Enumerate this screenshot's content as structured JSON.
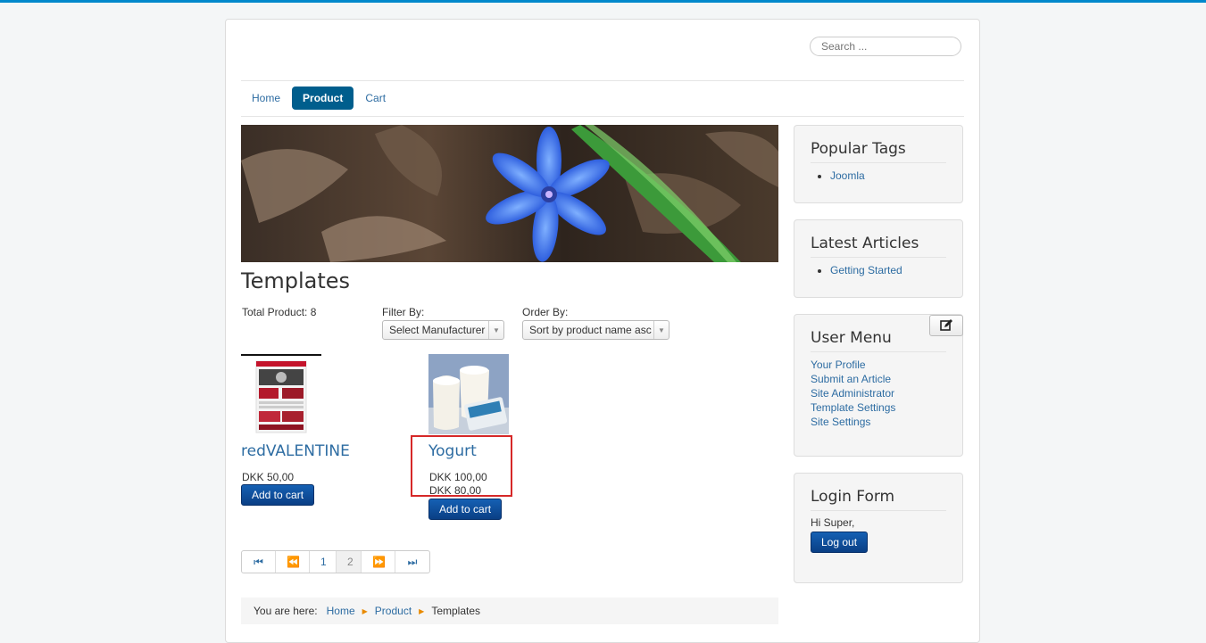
{
  "search": {
    "placeholder": "Search ..."
  },
  "nav": {
    "items": [
      "Home",
      "Product",
      "Cart"
    ],
    "active": "Product"
  },
  "main": {
    "title": "Templates",
    "total": "Total Product: 8",
    "filter_label": "Filter By:",
    "filter_value": "Select Manufacturer",
    "order_label": "Order By:",
    "order_value": "Sort by product name asc"
  },
  "products": [
    {
      "name": "redVALENTINE",
      "price": "DKK 50,00",
      "button": "Add to cart"
    },
    {
      "name": "Yogurt",
      "price": "DKK 100,00",
      "sale_price": "DKK 80,00",
      "button": "Add to cart"
    }
  ],
  "pager": {
    "pages": [
      "1",
      "2"
    ],
    "current": "2"
  },
  "breadcrumb": {
    "prefix": "You are here:",
    "items": [
      "Home",
      "Product",
      "Templates"
    ]
  },
  "modules": {
    "tags": {
      "title": "Popular Tags",
      "items": [
        "Joomla"
      ]
    },
    "articles": {
      "title": "Latest Articles",
      "items": [
        "Getting Started"
      ]
    },
    "user_menu": {
      "title": "User Menu",
      "items": [
        "Your Profile",
        "Submit an Article",
        "Site Administrator",
        "Template Settings",
        "Site Settings"
      ]
    },
    "login": {
      "title": "Login Form",
      "greeting": "Hi Super,",
      "button": "Log out"
    }
  },
  "colors": {
    "accent": "#0088cc",
    "nav_active": "#005e8d",
    "link": "#2d6ca2",
    "button": "#0a3f85",
    "highlight": "#d62828"
  }
}
